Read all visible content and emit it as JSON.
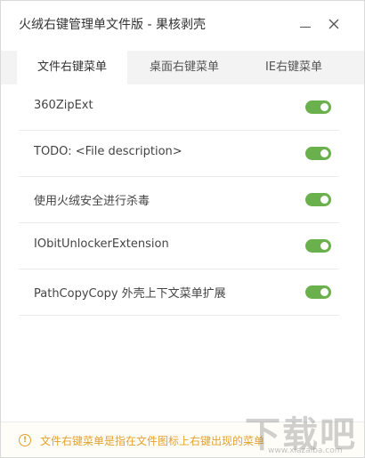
{
  "window": {
    "title": "火绒右键管理单文件版 - 果核剥壳",
    "minimize_icon": "minimize-icon",
    "close_icon": "close-icon"
  },
  "tabs": [
    {
      "label": "文件右键菜单",
      "active": true
    },
    {
      "label": "桌面右键菜单",
      "active": false
    },
    {
      "label": "IE右键菜单",
      "active": false
    }
  ],
  "items": [
    {
      "label": "360ZipExt",
      "enabled": true
    },
    {
      "label": "TODO: <File description>",
      "enabled": true
    },
    {
      "label": "使用火绒安全进行杀毒",
      "enabled": true
    },
    {
      "label": "IObitUnlockerExtension",
      "enabled": true
    },
    {
      "label": "PathCopyCopy 外壳上下文菜单扩展",
      "enabled": true
    }
  ],
  "footer": {
    "tip_icon": "info-icon",
    "tip_glyph": "!",
    "tip_text": "文件右键菜单是指在文件图标上右键出现的菜单"
  },
  "watermark": {
    "brand": "下载吧",
    "url": "www.xiazaiba.com"
  },
  "colors": {
    "toggle_on": "#6ab04c",
    "tip": "#e2a12f",
    "tab_bar": "#f3f3f3"
  }
}
